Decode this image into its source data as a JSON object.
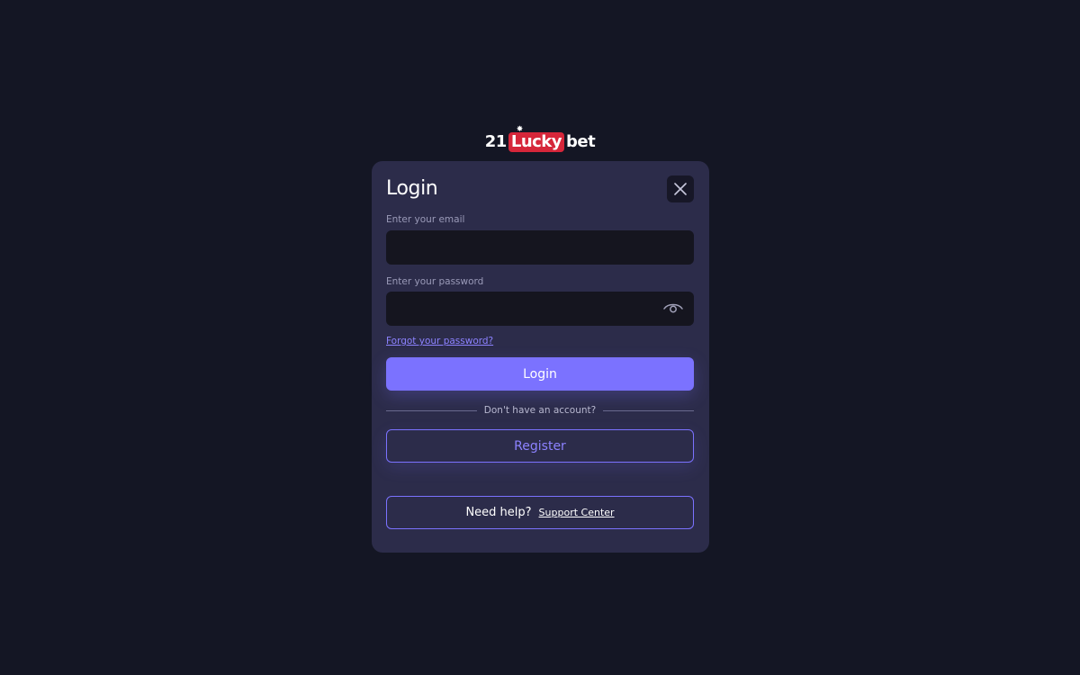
{
  "logo": {
    "part1": "21",
    "part2": "Lucky",
    "part3": "bet",
    "chip_glyph": "✸",
    "accent_color": "#d6263a"
  },
  "modal": {
    "title": "Login",
    "close_icon": "close-icon",
    "email": {
      "label": "Enter your email",
      "value": "",
      "placeholder": ""
    },
    "password": {
      "label": "Enter your password",
      "value": "",
      "placeholder": "",
      "toggle_icon": "eye-icon"
    },
    "forgot_password": "Forgot your password?",
    "login_button": "Login",
    "divider_text": "Don't have an account?",
    "register_button": "Register",
    "help": {
      "text": "Need help?",
      "link": "Support Center"
    }
  },
  "colors": {
    "background": "#141624",
    "modal": "#2c2c4a",
    "input": "#15151f",
    "primary": "#7b72ff"
  }
}
